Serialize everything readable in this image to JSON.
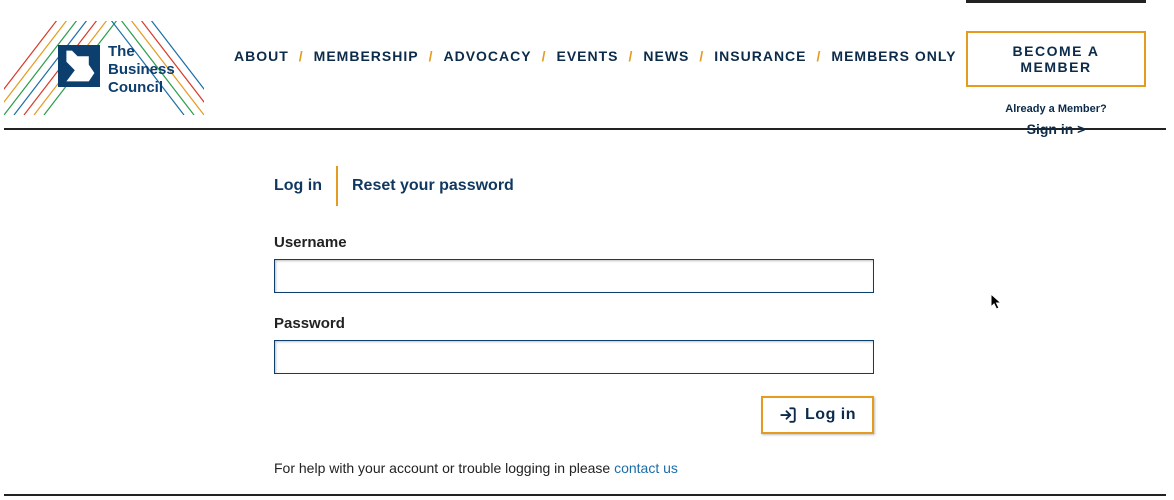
{
  "logo": {
    "text_line1": "The",
    "text_line2": "Business",
    "text_line3": "Council"
  },
  "nav": {
    "items": [
      "ABOUT",
      "MEMBERSHIP",
      "ADVOCACY",
      "EVENTS",
      "NEWS",
      "INSURANCE",
      "MEMBERS ONLY"
    ]
  },
  "cta": {
    "label": "BECOME A MEMBER",
    "already": "Already a Member?",
    "signin": "Sign in >"
  },
  "tabs": {
    "login": "Log in",
    "reset": "Reset your password"
  },
  "form": {
    "username_label": "Username",
    "username_value": "",
    "password_label": "Password",
    "password_value": "",
    "login_button": "Log in"
  },
  "help": {
    "prefix": "For help with your account or trouble logging in please ",
    "link": "contact us"
  }
}
